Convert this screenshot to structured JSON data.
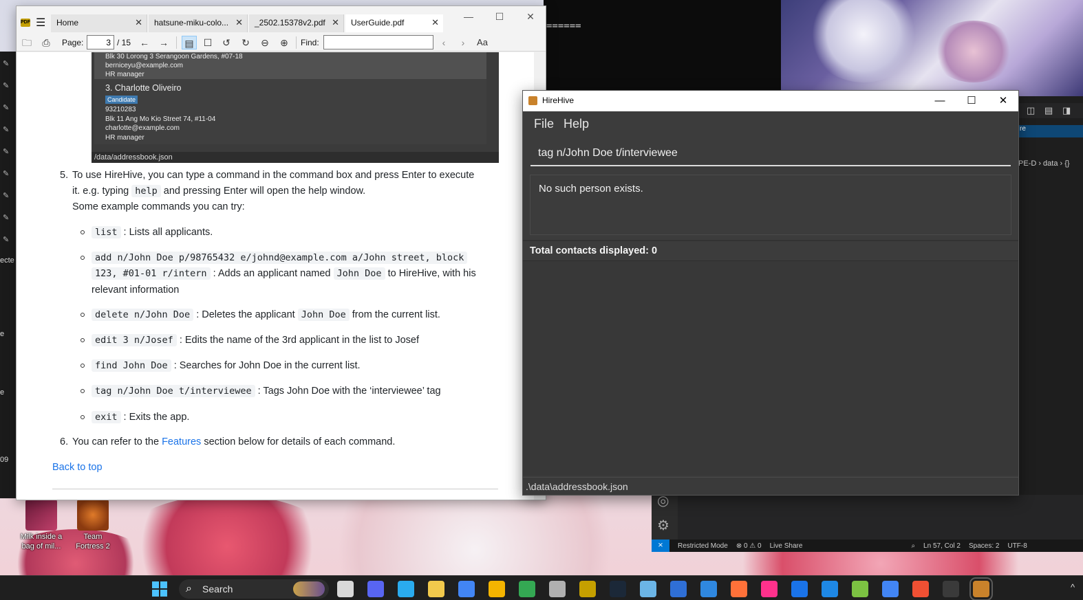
{
  "terminal": {
    "text": "======"
  },
  "vscode": {
    "tab_fragment": "re",
    "breadcrumb": "PE-D › data › {}",
    "status": {
      "restricted_mode": "Restricted Mode",
      "problems": "⊗ 0 ⚠ 0",
      "live_share": "Live Share",
      "cursor": "Ln 57, Col 2",
      "spaces": "Spaces: 2",
      "encoding": "UTF-8"
    }
  },
  "desktop_icons": [
    {
      "label": "Milk inside a bag of mil...",
      "icon": "game-icon"
    },
    {
      "label": "Team Fortress 2",
      "icon": "tf2-icon"
    }
  ],
  "side_fragments": {
    "a": "ecte",
    "b": "e",
    "c": "e",
    "d": "09"
  },
  "pdf_viewer": {
    "tabs": [
      {
        "label": "Home",
        "active": false
      },
      {
        "label": "hatsune-miku-colo...",
        "active": false
      },
      {
        "label": "_2502.15378v2.pdf",
        "active": false
      },
      {
        "label": "UserGuide.pdf",
        "active": true
      }
    ],
    "toolbar": {
      "page_label": "Page:",
      "page_value": "3",
      "page_total": "/ 15",
      "find_label": "Find:",
      "find_value": "",
      "text_size_glyph": "Aa"
    },
    "screenshot": {
      "card1_lines": [
        "Blk 30 Lorong 3 Serangoon Gardens, #07-18",
        "berniceyu@example.com",
        "HR manager"
      ],
      "card2_name": "3. Charlotte Oliveiro",
      "card2_badge": "Candidate",
      "card2_lines": [
        "93210283",
        "Blk 11 Ang Mo Kio Street 74, #11-04",
        "charlotte@example.com",
        "HR manager"
      ],
      "status": "/data/addressbook.json"
    },
    "doc": {
      "step5_num": "5.",
      "step5_line1": "To use HireHive, you can type a command in the command box and press Enter to execute",
      "step5_pre": "it. e.g. typing",
      "step5_code": "help",
      "step5_post": "and pressing Enter will open the help window.",
      "step5_line3": "Some example commands you can try:",
      "bullets": [
        {
          "code": "list",
          "text": ": Lists all applicants."
        },
        {
          "code_a": "add n/John Doe p/98765432 e/johnd@example.com a/John street, block",
          "code_b": "123, #01-01 r/intern",
          "text_a": ": Adds an applicant named",
          "code_c": "John Doe",
          "text_b": "to HireHive, with his",
          "text_c": "relevant information"
        },
        {
          "code": "delete n/John Doe",
          "text_a": ": Deletes the applicant",
          "code_b": "John Doe",
          "text_b": "from the current list."
        },
        {
          "code": "edit 3 n/Josef",
          "text": ": Edits the name of the 3rd applicant in the list to Josef"
        },
        {
          "code": "find John Doe",
          "text": ": Searches for John Doe in the current list."
        },
        {
          "code": "tag n/John Doe t/interviewee",
          "text": ": Tags John Doe with the ‘interviewee’ tag"
        },
        {
          "code": "exit",
          "text": ": Exits the app."
        }
      ],
      "step6_num": "6.",
      "step6_pre": "You can refer to the",
      "step6_link": "Features",
      "step6_post": "section below for details of each command.",
      "back_to_top": "Back to top"
    }
  },
  "hirehive": {
    "title": "HireHive",
    "menu": [
      "File",
      "Help"
    ],
    "command_value": "tag n/John Doe t/interviewee",
    "result": "No such person exists.",
    "total_contacts": "Total contacts displayed: 0",
    "status_path": ".\\data\\addressbook.json"
  },
  "taskbar": {
    "search_label": "Search",
    "apps": [
      "photos-icon",
      "discord-icon",
      "telegram-icon",
      "file-explorer-icon",
      "chrome-icon",
      "chrome-canary-icon",
      "chrome-beta-icon",
      "app-icon",
      "pdf-xchange-icon",
      "steam-icon",
      "photos-app-icon",
      "notepad-icon",
      "vscode-icon",
      "firefox-icon",
      "intellij-icon",
      "maps-icon",
      "m-app-icon",
      "bluestacks-icon",
      "g-app-icon",
      "git-icon",
      "terminal-icon",
      "hirehive-icon"
    ]
  },
  "colors": {
    "hirehive_bg": "#3c3c3c",
    "link_blue": "#1a73e8",
    "taskbar_bg": "#1f1f1f",
    "vscode_blue": "#0078d4"
  }
}
